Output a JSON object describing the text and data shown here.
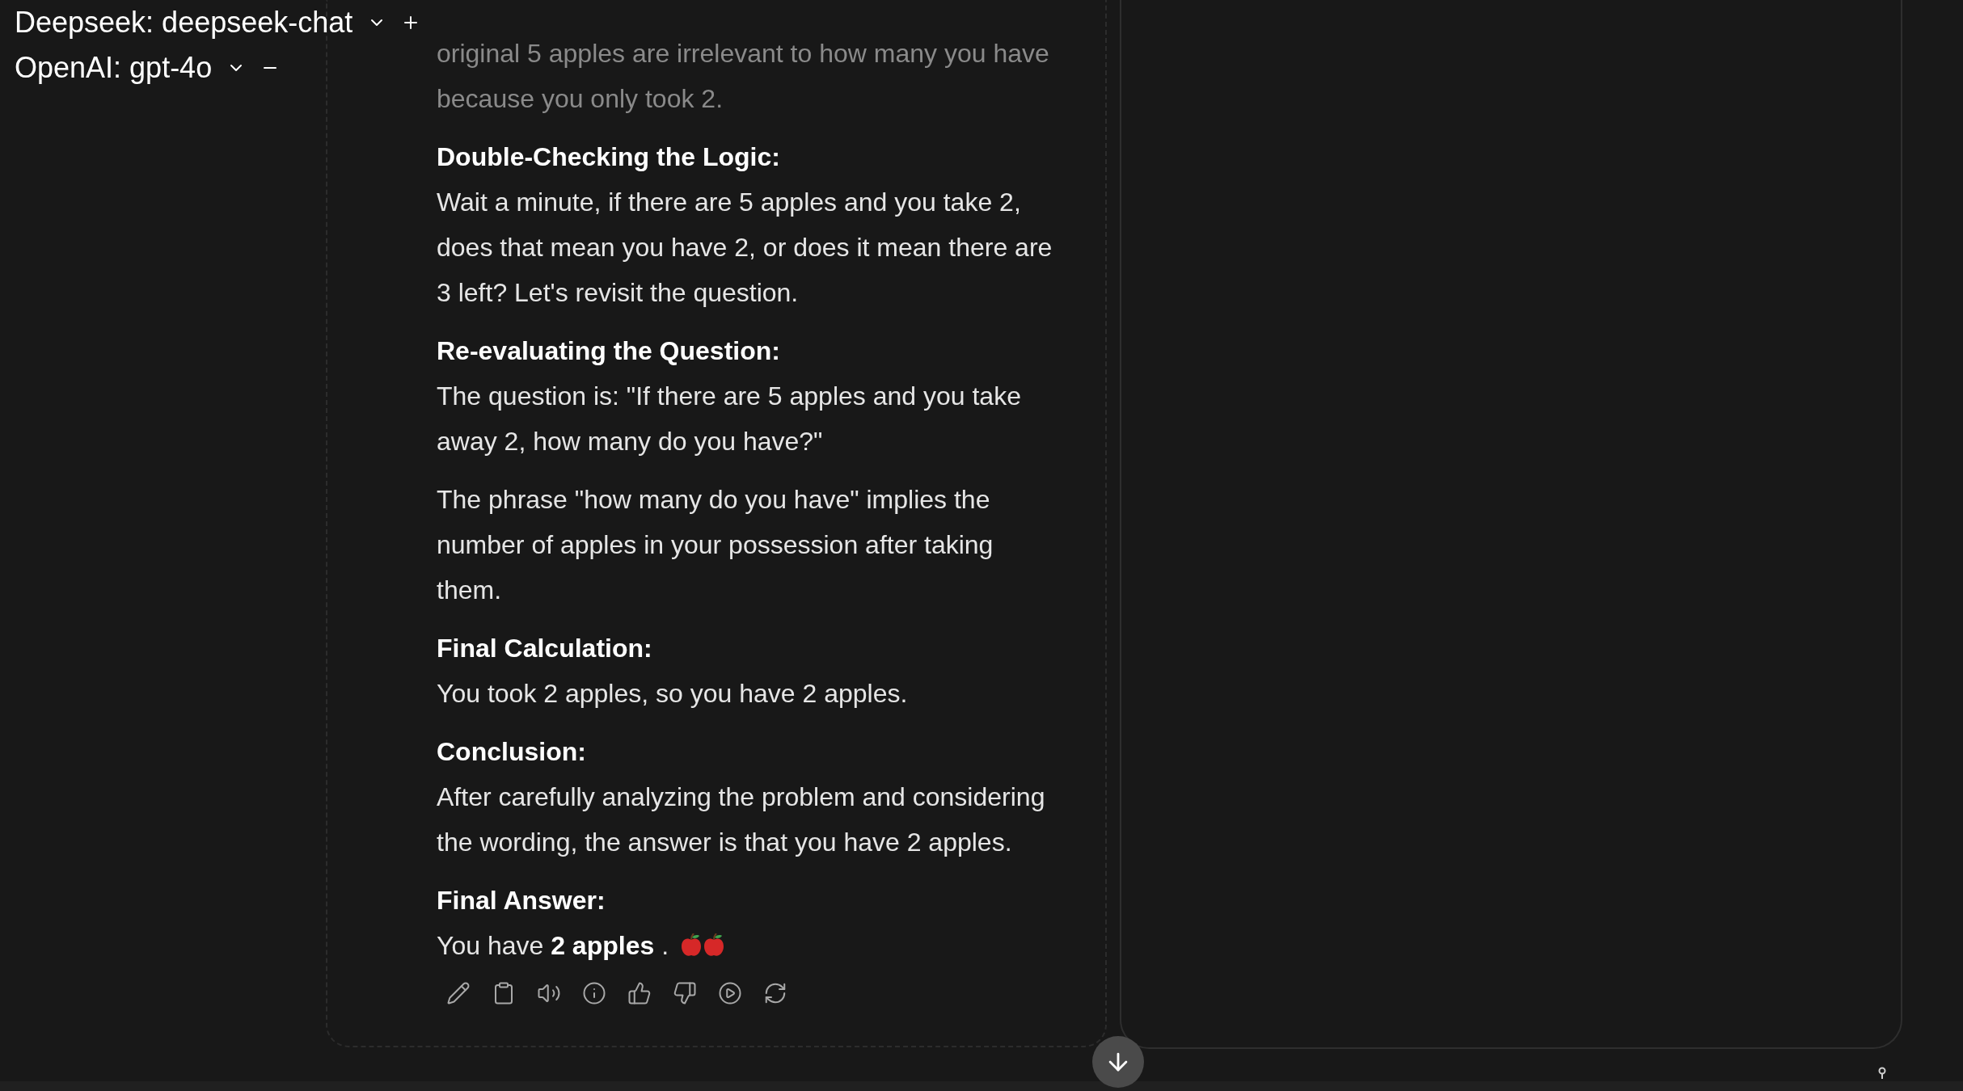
{
  "header": {
    "models": [
      {
        "label": "Deepseek: deepseek-chat",
        "kind": "add"
      },
      {
        "label": "OpenAI: gpt-4o",
        "kind": "remove"
      }
    ]
  },
  "message": {
    "blocks": [
      {
        "kind": "faded",
        "text": "original 5 apples are irrelevant to how many you have"
      },
      {
        "kind": "faded",
        "text": "because you only took 2."
      },
      {
        "kind": "heading",
        "text": "Double-Checking the Logic:"
      },
      {
        "kind": "paragraph",
        "text": "Wait a minute, if there are 5 apples and you take 2, does that mean you have 2, or does it mean there are 3 left? Let's revisit the question."
      },
      {
        "kind": "heading",
        "text": "Re-evaluating the Question:"
      },
      {
        "kind": "paragraph",
        "text": "The question is: \"If there are 5 apples and you take away 2, how many do you have?\""
      },
      {
        "kind": "paragraph",
        "text": "The phrase \"how many do you have\" implies the number of apples in your possession after taking them."
      },
      {
        "kind": "heading",
        "text": "Final Calculation:"
      },
      {
        "kind": "paragraph",
        "text": "You took 2 apples, so you have 2 apples."
      },
      {
        "kind": "heading",
        "text": "Conclusion:"
      },
      {
        "kind": "paragraph",
        "text": "After carefully analyzing the problem and considering the wording, the answer is that you have 2 apples."
      },
      {
        "kind": "heading",
        "text": "Final Answer:"
      },
      {
        "kind": "answer",
        "text": "You have **2 apples** ."
      }
    ]
  }
}
